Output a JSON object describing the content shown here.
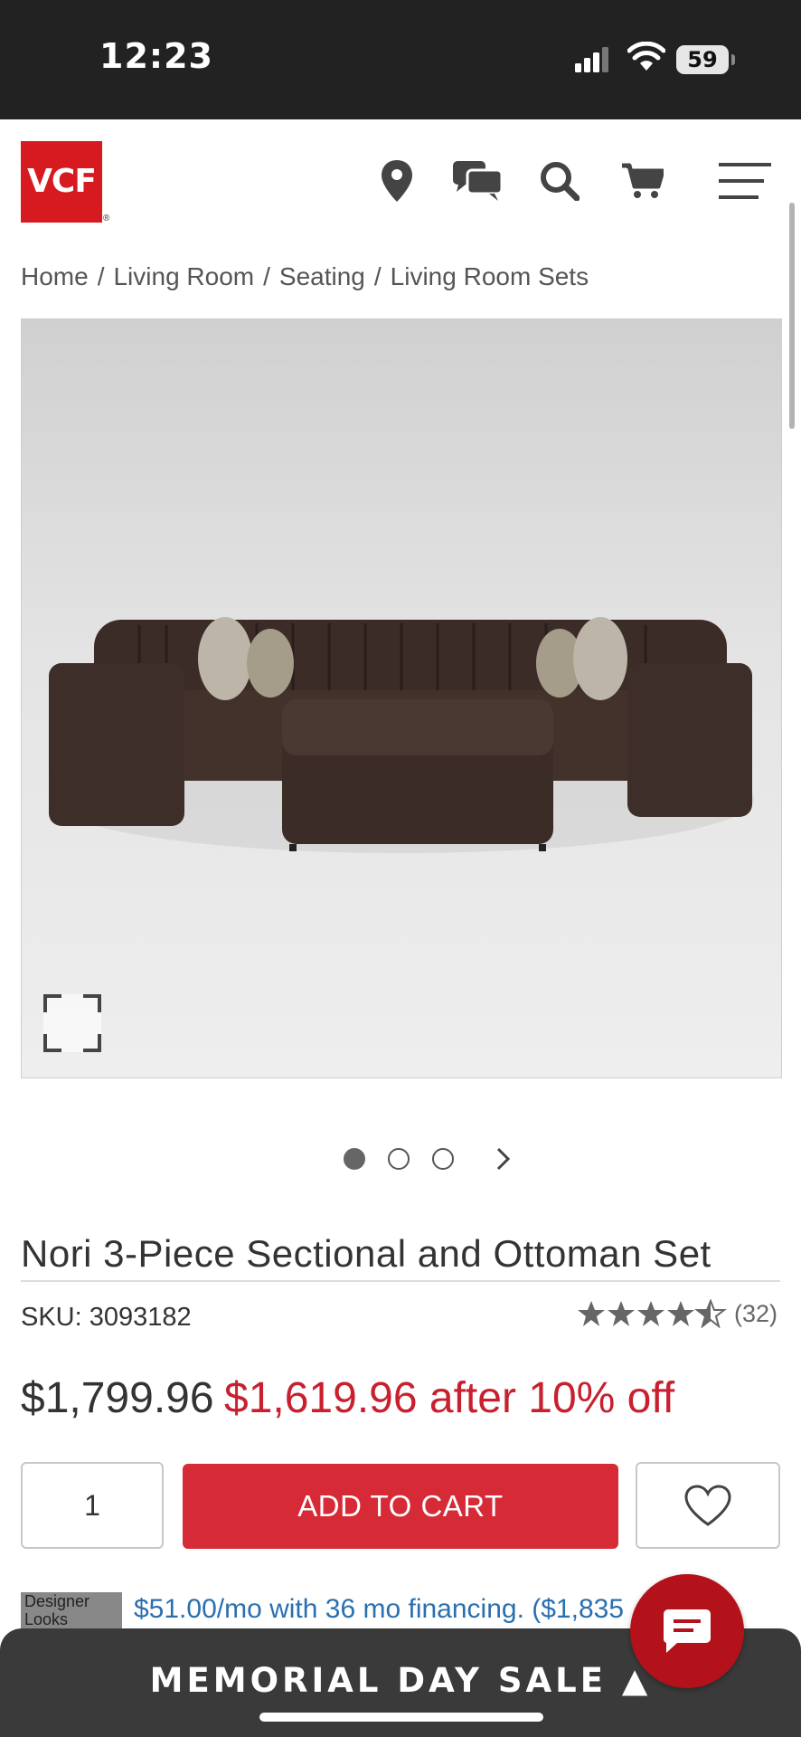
{
  "status_bar": {
    "time": "12:23",
    "battery": "59"
  },
  "brand": {
    "logo_text": "VCF",
    "accent": "#d71920"
  },
  "header_icons": [
    "location-icon",
    "chat-icon",
    "search-icon",
    "cart-icon",
    "menu-icon"
  ],
  "breadcrumb": [
    {
      "label": "Home"
    },
    {
      "label": "Living Room"
    },
    {
      "label": "Seating"
    },
    {
      "label": "Living Room Sets"
    }
  ],
  "breadcrumb_sep": "/",
  "gallery": {
    "current": 1,
    "total": 3
  },
  "product": {
    "title": "Nori 3-Piece Sectional and Ottoman Set",
    "sku": "SKU: 3093182",
    "rating": 4.5,
    "review_count": "(32)",
    "price": "$1,799.96",
    "sale_price": "$1,619.96 after 10% off",
    "sale_color": "#c8202f"
  },
  "purchase": {
    "quantity": "1",
    "add_to_cart_label": "ADD TO CART",
    "add_to_cart_color": "#d72a37"
  },
  "financing": {
    "logo_text": "Designer Looks",
    "text": "$51.00/mo with 36 mo financing. ($1,835"
  },
  "promo_bar": {
    "label": "MEMORIAL DAY SALE ▲"
  }
}
